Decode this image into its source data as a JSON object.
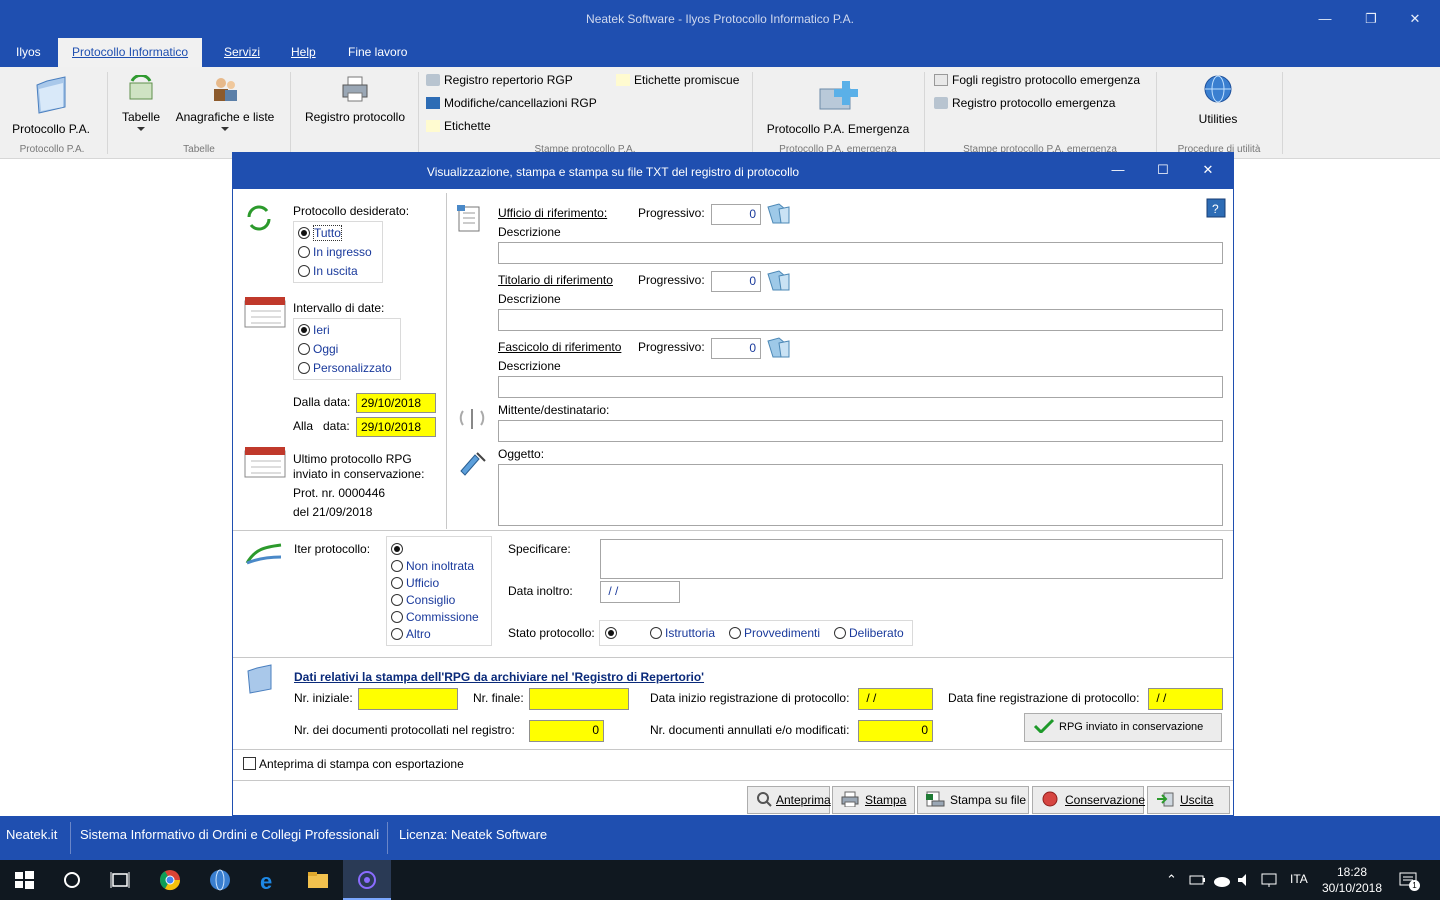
{
  "window": {
    "title": "Neatek Software - Ilyos Protocollo Informatico P.A."
  },
  "menu": {
    "items": [
      "Ilyos",
      "Protocollo Informatico",
      "Servizi",
      "Help",
      "Fine lavoro"
    ]
  },
  "ribbon": {
    "protocollo_pa": "Protocollo P.A.",
    "group_protocollo": "Protocollo P.A.",
    "tabelle": "Tabelle",
    "anagrafiche": "Anagrafiche e liste",
    "group_tabelle": "Tabelle",
    "registro_protocollo": "Registro protocollo",
    "registro_repertorio": "Registro repertorio RGP",
    "modifiche": "Modifiche/cancellazioni RGP",
    "etichette": "Etichette",
    "etichette_promiscue": "Etichette promiscue",
    "group_stampe": "Stampe protocollo P.A.",
    "emergenza": "Protocollo P.A. Emergenza",
    "group_emergenza": "Protocollo P.A. emergenza",
    "fogli_emergenza": "Fogli registro protocollo emergenza",
    "registro_emergenza": "Registro protocollo emergenza",
    "group_stampe_emergenza": "Stampe protocollo P.A. emergenza",
    "utilities": "Utilities",
    "group_utilita": "Procedure di utilità"
  },
  "dialog": {
    "title": "Visualizzazione, stampa e stampa su file TXT del registro di protocollo",
    "protocollo_desiderato": {
      "label": "Protocollo desiderato:",
      "options": [
        "Tutto",
        "In ingresso",
        "In uscita"
      ],
      "selected": 0
    },
    "intervallo": {
      "label": "Intervallo di date:",
      "options": [
        "Ieri",
        "Oggi",
        "Personalizzato"
      ],
      "selected": 0
    },
    "dalla_label": "Dalla data:",
    "dalla_value": "29/10/2018",
    "alla_label": "Alla   data:",
    "alla_value": "29/10/2018",
    "ultimo_label1": "Ultimo protocollo RPG",
    "ultimo_label2": "inviato in conservazione:",
    "prot_nr": "Prot. nr. 0000446",
    "prot_del": "del 21/09/2018",
    "ufficio_label": "Ufficio di riferimento:",
    "titolario_label": "Titolario di riferimento",
    "fascicolo_label": "Fascicolo di riferimento",
    "progressivo_label": "Progressivo:",
    "progressivo_value": "0",
    "descrizione_label": "Descrizione",
    "mittente_label": "Mittente/destinatario:",
    "oggetto_label": "Oggetto:",
    "iter_label": "Iter protocollo:",
    "iter_options": [
      "",
      "Non inoltrata",
      "Ufficio",
      "Consiglio",
      "Commissione",
      "Altro"
    ],
    "iter_selected": 0,
    "specificare_label": "Specificare:",
    "data_inoltro_label": "Data inoltro:",
    "data_inoltro_value": " / /",
    "stato_label": "Stato protocollo:",
    "stato_options": [
      "",
      "Istruttoria",
      "Provvedimenti",
      "Deliberato"
    ],
    "stato_selected": 0,
    "rpg_title": "Dati relativi la stampa dell'RPG da archiviare nel  'Registro di Repertorio'",
    "nr_iniziale_label": "Nr. iniziale:",
    "nr_finale_label": "Nr. finale:",
    "data_inizio_label": "Data inizio registrazione di protocollo:",
    "data_inizio_value": " / /",
    "data_fine_label": "Data fine registrazione di protocollo:",
    "data_fine_value": " / /",
    "nr_documenti_label": "Nr. dei documenti protocollati nel registro:",
    "nr_documenti_value": "0",
    "nr_annullati_label": "Nr. documenti annullati e/o modificati:",
    "nr_annullati_value": "0",
    "rpg_inviato_button": "RPG inviato in conservazione",
    "anteprima_checkbox": "Anteprima di stampa con esportazione",
    "buttons": {
      "anteprima": "Anteprima",
      "stampa": "Stampa",
      "stampa_file": "Stampa su file",
      "conservazione": "Conservazione",
      "uscita": "Uscita"
    }
  },
  "statusbar": {
    "site": "Neatek.it",
    "sistema": "Sistema Informativo di Ordini e Collegi Professionali",
    "licenza": "Licenza: Neatek Software"
  },
  "taskbar": {
    "lang": "ITA",
    "time": "18:28",
    "date": "30/10/2018",
    "notifications": "1"
  }
}
